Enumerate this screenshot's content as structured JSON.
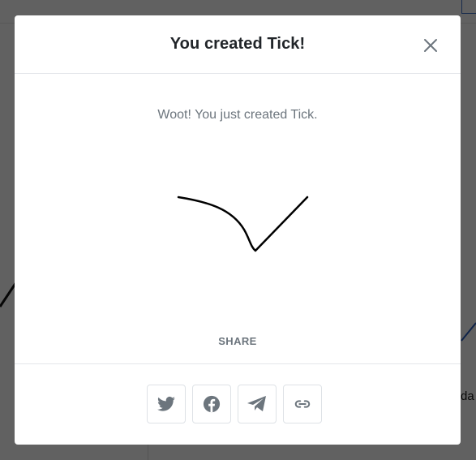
{
  "modal": {
    "title": "You created Tick!",
    "message": "Woot! You just created Tick.",
    "share_label": "SHARE",
    "close_icon": "close-icon",
    "drawing_name": "Tick",
    "share_buttons": [
      {
        "icon": "twitter-icon",
        "label": "Twitter"
      },
      {
        "icon": "facebook-icon",
        "label": "Facebook"
      },
      {
        "icon": "telegram-icon",
        "label": "Telegram"
      },
      {
        "icon": "link-icon",
        "label": "Copy link"
      }
    ]
  },
  "background": {
    "partial_text": "da"
  },
  "colors": {
    "overlay": "#000000",
    "icon": "#6c757d",
    "title": "#212529",
    "stroke": "#000000"
  }
}
